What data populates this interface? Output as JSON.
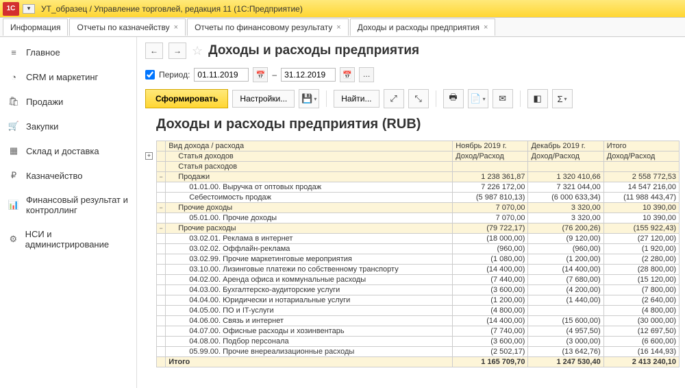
{
  "window": {
    "title": "УТ_образец / Управление торговлей, редакция 11  (1С:Предприятие)"
  },
  "tabs": [
    {
      "label": "Информация",
      "close": false
    },
    {
      "label": "Отчеты по казначейству",
      "close": true
    },
    {
      "label": "Отчеты по финансовому результату",
      "close": true
    },
    {
      "label": "Доходы и расходы предприятия",
      "close": true,
      "active": true
    }
  ],
  "sidebar": [
    {
      "label": "Главное",
      "icon": "≡"
    },
    {
      "label": "CRM и маркетинг",
      "icon": "◔"
    },
    {
      "label": "Продажи",
      "icon": "🛍"
    },
    {
      "label": "Закупки",
      "icon": "🛒"
    },
    {
      "label": "Склад и доставка",
      "icon": "▦"
    },
    {
      "label": "Казначейство",
      "icon": "₽"
    },
    {
      "label": "Финансовый результат и контроллинг",
      "icon": "📊"
    },
    {
      "label": "НСИ и администрирование",
      "icon": "⚙"
    }
  ],
  "page": {
    "title": "Доходы и расходы предприятия"
  },
  "period": {
    "label": "Период:",
    "from": "01.11.2019",
    "to": "31.12.2019",
    "sep": "–"
  },
  "toolbar": {
    "generate": "Сформировать",
    "settings": "Настройки...",
    "find": "Найти..."
  },
  "report": {
    "title": "Доходы и расходы предприятия (RUB)",
    "columns": {
      "c0": "Вид дохода / расхода",
      "sub1": "Статья доходов",
      "sub2": "Статья расходов",
      "c1": "Ноябрь 2019 г.",
      "c2": "Декабрь 2019 г.",
      "c3": "Итого",
      "metric": "Доход/Расход"
    },
    "rows": [
      {
        "t": "g",
        "label": "Продажи",
        "v": [
          "1 238 361,87",
          "1 320 410,66",
          "2 558 772,53"
        ]
      },
      {
        "t": "d",
        "ind": 2,
        "label": "01.01.00. Выручка от оптовых продаж",
        "v": [
          "7 226 172,00",
          "7 321 044,00",
          "14 547 216,00"
        ]
      },
      {
        "t": "d",
        "ind": 2,
        "label": "Себестоимость продаж",
        "v": [
          "(5 987 810,13)",
          "(6 000 633,34)",
          "(11 988 443,47)"
        ]
      },
      {
        "t": "g",
        "label": "Прочие доходы",
        "v": [
          "7 070,00",
          "3 320,00",
          "10 390,00"
        ]
      },
      {
        "t": "d",
        "ind": 2,
        "label": "05.01.00. Прочие доходы",
        "v": [
          "7 070,00",
          "3 320,00",
          "10 390,00"
        ]
      },
      {
        "t": "g",
        "label": "Прочие расходы",
        "v": [
          "(79 722,17)",
          "(76 200,26)",
          "(155 922,43)"
        ]
      },
      {
        "t": "d",
        "ind": 2,
        "label": "03.02.01. Реклама в интернет",
        "v": [
          "(18 000,00)",
          "(9 120,00)",
          "(27 120,00)"
        ]
      },
      {
        "t": "d",
        "ind": 2,
        "label": "03.02.02. Оффлайн-реклама",
        "v": [
          "(960,00)",
          "(960,00)",
          "(1 920,00)"
        ]
      },
      {
        "t": "d",
        "ind": 2,
        "label": "03.02.99. Прочие маркетинговые мероприятия",
        "v": [
          "(1 080,00)",
          "(1 200,00)",
          "(2 280,00)"
        ]
      },
      {
        "t": "d",
        "ind": 2,
        "label": "03.10.00. Лизинговые платежи по собственному транспорту",
        "v": [
          "(14 400,00)",
          "(14 400,00)",
          "(28 800,00)"
        ]
      },
      {
        "t": "d",
        "ind": 2,
        "label": "04.02.00. Аренда офиса и коммунальные расходы",
        "v": [
          "(7 440,00)",
          "(7 680,00)",
          "(15 120,00)"
        ]
      },
      {
        "t": "d",
        "ind": 2,
        "label": "04.03.00. Бухгалтерско-аудиторские услуги",
        "v": [
          "(3 600,00)",
          "(4 200,00)",
          "(7 800,00)"
        ]
      },
      {
        "t": "d",
        "ind": 2,
        "label": "04.04.00. Юридически и нотариальные услуги",
        "v": [
          "(1 200,00)",
          "(1 440,00)",
          "(2 640,00)"
        ]
      },
      {
        "t": "d",
        "ind": 2,
        "label": "04.05.00. ПО и IT-услуги",
        "v": [
          "(4 800,00)",
          "",
          "(4 800,00)"
        ]
      },
      {
        "t": "d",
        "ind": 2,
        "label": "04.06.00. Связь и интернет",
        "v": [
          "(14 400,00)",
          "(15 600,00)",
          "(30 000,00)"
        ]
      },
      {
        "t": "d",
        "ind": 2,
        "label": "04.07.00. Офисные расходы и хозинвентарь",
        "v": [
          "(7 740,00)",
          "(4 957,50)",
          "(12 697,50)"
        ]
      },
      {
        "t": "d",
        "ind": 2,
        "label": "04.08.00. Подбор персонала",
        "v": [
          "(3 600,00)",
          "(3 000,00)",
          "(6 600,00)"
        ]
      },
      {
        "t": "d",
        "ind": 2,
        "label": "05.99.00. Прочие внереализационные расходы",
        "v": [
          "(2 502,17)",
          "(13 642,76)",
          "(16 144,93)"
        ]
      },
      {
        "t": "tot",
        "label": "Итого",
        "v": [
          "1 165 709,70",
          "1 247 530,40",
          "2 413 240,10"
        ]
      }
    ]
  }
}
